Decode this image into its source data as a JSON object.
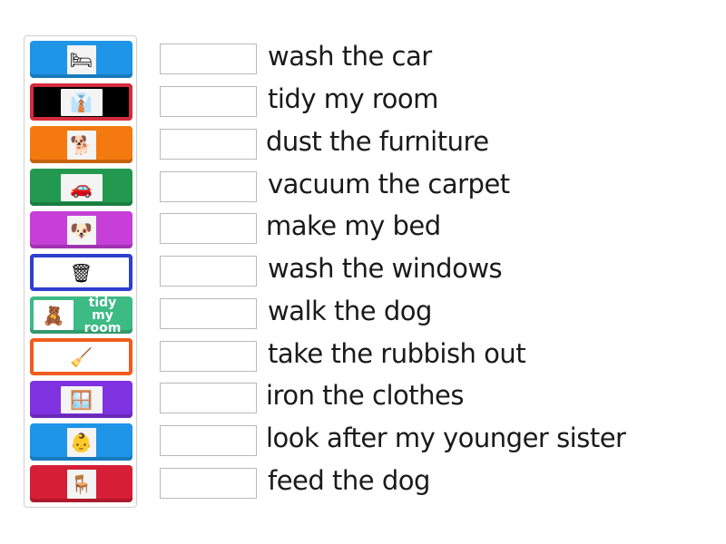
{
  "tiles": [
    {
      "color": "#1f95e8",
      "style": "solid",
      "image": "make-bed-image",
      "glyph": "🛏"
    },
    {
      "color": "#d52b3c",
      "style": "framed-black",
      "image": "iron-clothes-image",
      "glyph": "👔"
    },
    {
      "color": "#f47a10",
      "style": "solid",
      "image": "walk-dog-image",
      "glyph": "🐕"
    },
    {
      "color": "#22994f",
      "style": "solid",
      "image": "wash-car-image",
      "glyph": "🚗"
    },
    {
      "color": "#c53fd8",
      "style": "solid",
      "image": "feed-dog-image",
      "glyph": "🐶"
    },
    {
      "color": "#2f3fcf",
      "style": "framed",
      "image": "take-rubbish-out-image",
      "glyph": "🗑"
    },
    {
      "color": "#3dbb85",
      "style": "text",
      "image": "tidy-room-image",
      "glyph": "🧸",
      "text": "tidy my room"
    },
    {
      "color": "#f05c1e",
      "style": "framed",
      "image": "vacuum-carpet-image",
      "glyph": "🧹"
    },
    {
      "color": "#7f32e0",
      "style": "solid",
      "image": "wash-windows-image",
      "glyph": "🪟"
    },
    {
      "color": "#1f95e8",
      "style": "solid",
      "image": "look-after-sister-image",
      "glyph": "👶"
    },
    {
      "color": "#d61f36",
      "style": "solid",
      "image": "dust-furniture-image",
      "glyph": "🪑"
    }
  ],
  "answers": [
    {
      "label": "wash the car",
      "value": ""
    },
    {
      "label": "tidy my room",
      "value": ""
    },
    {
      "label": "dust the furniture",
      "value": ""
    },
    {
      "label": "vacuum the carpet",
      "value": ""
    },
    {
      "label": "make my bed",
      "value": ""
    },
    {
      "label": "wash the windows",
      "value": ""
    },
    {
      "label": "walk the dog",
      "value": ""
    },
    {
      "label": "take the rubbish out",
      "value": ""
    },
    {
      "label": "iron the clothes",
      "value": ""
    },
    {
      "label": "look after my younger sister",
      "value": ""
    },
    {
      "label": "feed the dog",
      "value": ""
    }
  ]
}
